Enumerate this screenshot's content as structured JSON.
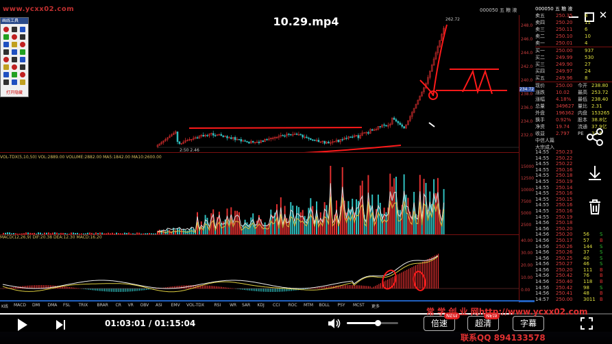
{
  "player": {
    "title": "10.29.mp4",
    "current_time": "01:03:01",
    "separator": "/",
    "total_time": "01:15:04",
    "speed_label": "倍速",
    "quality_label": "超清",
    "subtitle_label": "字幕",
    "new_badge": "NEW",
    "progress_fraction": 0.84,
    "volume_fraction": 0.6
  },
  "overlay": {
    "watermark": "www.ycxx02.com",
    "promo_line1": "常 学 创 业 网http://www.ycxx02.com",
    "promo_line2": "联系QQ 894133578"
  },
  "window": {
    "stock_code": "000050 五 粮 液"
  },
  "toolbox": {
    "title": "画线工具",
    "footer": "打开隐藏"
  },
  "info_strips": {
    "kline": "日线 前复权",
    "volume": "VOL-TDX(5,10,50) VOL:2889.00 VOLUME:2882.00 MA5:1842.00 MA10:2600.00",
    "macd": "MACD(12,26,9) DIF:20.38 DEA:12.30 MACD:16.20"
  },
  "kline": {
    "marker_high": "262.72",
    "marker_price": "234.72",
    "start_label": "2:50",
    "start_value": "2.46"
  },
  "axis_right": {
    "kline_ticks": [
      "248.0",
      "246.0",
      "244.0",
      "242.0",
      "240.0",
      "238.0",
      "236.0",
      "234.0",
      "232.0"
    ],
    "vol_ticks": [
      "15000",
      "12500",
      "10000",
      "7500",
      "5000",
      "2500"
    ],
    "macd_ticks": [
      "40.00",
      "30.00",
      "20.00",
      "10.00",
      "0.00"
    ]
  },
  "order_book": {
    "sell": [
      {
        "label": "卖五",
        "price": "250.35",
        "vol": "8"
      },
      {
        "label": "卖四",
        "price": "250.20",
        "vol": "11"
      },
      {
        "label": "卖三",
        "price": "250.11",
        "vol": "6"
      },
      {
        "label": "卖二",
        "price": "250.10",
        "vol": "10"
      },
      {
        "label": "卖一",
        "price": "250.01",
        "vol": "4"
      }
    ],
    "buy": [
      {
        "label": "买一",
        "price": "250.00",
        "vol": "937"
      },
      {
        "label": "买二",
        "price": "249.99",
        "vol": "530"
      },
      {
        "label": "买三",
        "price": "249.90",
        "vol": "27"
      },
      {
        "label": "买四",
        "price": "249.97",
        "vol": "24"
      },
      {
        "label": "买五",
        "price": "249.96",
        "vol": "8"
      }
    ],
    "stats": [
      {
        "label": "现价",
        "value": "250.00",
        "label2": "今开",
        "value2": "238.80"
      },
      {
        "label": "涨跌",
        "value": "10.02",
        "label2": "最高",
        "value2": "253.72"
      },
      {
        "label": "涨幅",
        "value": "4.18%",
        "label2": "最低",
        "value2": "238.40"
      },
      {
        "label": "总量",
        "value": "349627",
        "label2": "量比",
        "value2": "2.31"
      },
      {
        "label": "外盘",
        "value": "196362",
        "label2": "内盘",
        "value2": "153265"
      },
      {
        "label": "换手",
        "value": "0.92%",
        "label2": "股本",
        "value2": "38.8亿"
      },
      {
        "label": "净资",
        "value": "19.74",
        "label2": "流通",
        "value2": "37.9亿"
      },
      {
        "label": "收益",
        "value": "2.797",
        "label2": "PE",
        "value2": "33.5"
      }
    ],
    "footer1": "中信人篇",
    "footer2": "大宗成入"
  },
  "ticks": [
    {
      "t": "14:55",
      "p": "250.23",
      "v": "",
      "d": ""
    },
    {
      "t": "14:55",
      "p": "250.22",
      "v": "",
      "d": ""
    },
    {
      "t": "14:55",
      "p": "250.22",
      "v": "",
      "d": ""
    },
    {
      "t": "14:55",
      "p": "250.16",
      "v": "",
      "d": ""
    },
    {
      "t": "14:55",
      "p": "250.18",
      "v": "",
      "d": ""
    },
    {
      "t": "14:55",
      "p": "250.19",
      "v": "",
      "d": ""
    },
    {
      "t": "14:55",
      "p": "250.14",
      "v": "",
      "d": ""
    },
    {
      "t": "14:55",
      "p": "250.16",
      "v": "",
      "d": ""
    },
    {
      "t": "14:55",
      "p": "250.15",
      "v": "",
      "d": ""
    },
    {
      "t": "14:55",
      "p": "250.16",
      "v": "",
      "d": ""
    },
    {
      "t": "14:55",
      "p": "250.16",
      "v": "",
      "d": ""
    },
    {
      "t": "14:55",
      "p": "250.19",
      "v": "",
      "d": ""
    },
    {
      "t": "14:56",
      "p": "250.18",
      "v": "",
      "d": ""
    },
    {
      "t": "14:56",
      "p": "250.20",
      "v": "",
      "d": ""
    },
    {
      "t": "14:56",
      "p": "250.20",
      "v": "56",
      "d": "S"
    },
    {
      "t": "14:56",
      "p": "250.17",
      "v": "57",
      "d": "B"
    },
    {
      "t": "14:56",
      "p": "250.26",
      "v": "144",
      "d": "S"
    },
    {
      "t": "14:56",
      "p": "250.26",
      "v": "37",
      "d": "S"
    },
    {
      "t": "14:56",
      "p": "250.25",
      "v": "40",
      "d": "S"
    },
    {
      "t": "14:56",
      "p": "250.27",
      "v": "46",
      "d": "S"
    },
    {
      "t": "14:56",
      "p": "250.20",
      "v": "111",
      "d": "B"
    },
    {
      "t": "14:56",
      "p": "250.42",
      "v": "76",
      "d": "B"
    },
    {
      "t": "14:56",
      "p": "250.40",
      "v": "118",
      "d": "B"
    },
    {
      "t": "14:56",
      "p": "250.42",
      "v": "98",
      "d": "S"
    },
    {
      "t": "14:56",
      "p": "250.41",
      "v": "48",
      "d": "B"
    },
    {
      "t": "14:57",
      "p": "250.00",
      "v": "3011",
      "d": "B"
    }
  ],
  "bottom_tabs": [
    "K线",
    "MACD",
    "DMI",
    "DMA",
    "FSL",
    "TRIX",
    "BRAR",
    "CR",
    "VR",
    "OBV",
    "ASI",
    "EMV",
    "VOL-TDX",
    "RSI",
    "WR",
    "SAR",
    "KDJ",
    "CCI",
    "ROC",
    "MTM",
    "BOLL",
    "PSY",
    "MCST",
    "更多"
  ],
  "colors": {
    "up": "#e03030",
    "down": "#30c0c0",
    "accent_line": "#ff2020",
    "progress": "#ffffff"
  },
  "icons": [
    "play-icon",
    "next-icon",
    "volume-icon",
    "fullscreen-icon",
    "share-icon",
    "download-icon",
    "delete-icon",
    "close-icon",
    "minimize-icon"
  ]
}
